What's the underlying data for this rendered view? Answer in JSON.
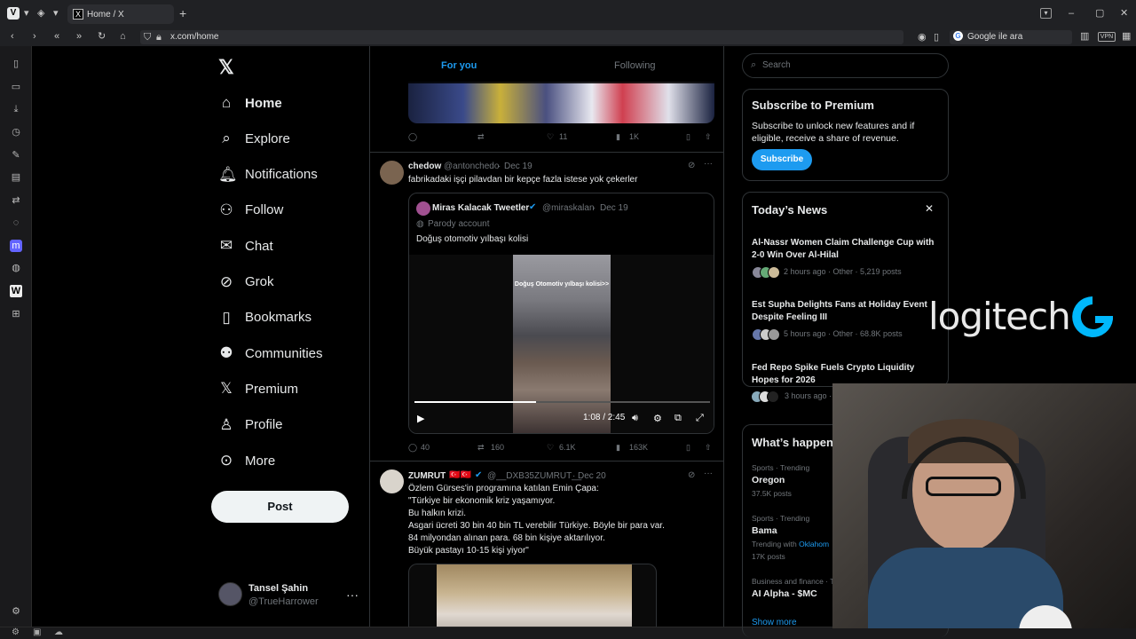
{
  "browser": {
    "tab_title": "Home / X",
    "url": "x.com/home",
    "search_placeholder": "Google ile ara",
    "vpn_label": "VPN"
  },
  "nav": {
    "items": [
      {
        "label": "Home",
        "icon": "home-icon"
      },
      {
        "label": "Explore",
        "icon": "search-icon"
      },
      {
        "label": "Notifications",
        "icon": "bell-icon"
      },
      {
        "label": "Follow",
        "icon": "person-plus-icon"
      },
      {
        "label": "Chat",
        "icon": "mail-icon"
      },
      {
        "label": "Grok",
        "icon": "grok-icon"
      },
      {
        "label": "Bookmarks",
        "icon": "bookmark-icon"
      },
      {
        "label": "Communities",
        "icon": "people-icon"
      },
      {
        "label": "Premium",
        "icon": "x-logo-icon"
      },
      {
        "label": "Profile",
        "icon": "person-icon"
      },
      {
        "label": "More",
        "icon": "more-circle-icon"
      }
    ],
    "post_label": "Post",
    "profile": {
      "name": "Tansel Şahin",
      "handle": "@TrueHarrower"
    }
  },
  "timeline": {
    "tabs": [
      "For you",
      "Following"
    ],
    "prev_tweet_actions": {
      "likes": "11",
      "views": "1K"
    },
    "tweet1": {
      "name": "chedow",
      "handle": "@antonchedo",
      "date": "Dec 19",
      "text": "fabrikadaki işçi pilavdan bir kepçe fazla istese yok çekerler",
      "quote": {
        "name": "Miras Kalacak Tweetler",
        "handle": "@miraskalan",
        "date": "Dec 19",
        "label": "Parody account",
        "text": "Doğuş otomotiv yılbaşı kolisi",
        "video_caption": "Doğuş Otomotiv yılbaşı kolisi>>",
        "time": "1:08 / 2:45",
        "progress": 0.41
      },
      "actions": {
        "replies": "40",
        "reposts": "160",
        "likes": "6.1K",
        "views": "163K"
      }
    },
    "tweet2": {
      "name": "ZUMRUT",
      "flags": "🇹🇷🇹🇷",
      "handle": "@__DXB35ZUMRUT__",
      "date": "Dec 20",
      "lines": [
        "Özlem Gürses'in programına katılan Emin Çapa:",
        "\"Türkiye bir ekonomik kriz yaşamıyor.",
        "Bu halkın krizi.",
        "Asgari ücreti 30 bin 40 bin TL verebilir Türkiye. Böyle bir para var.",
        "84 milyondan alınan para. 68 bin kişiye aktarılıyor.",
        "Büyük pastayı 10-15 kişi yiyor\""
      ]
    }
  },
  "sidebar": {
    "search_placeholder": "Search",
    "premium": {
      "title": "Subscribe to Premium",
      "body": "Subscribe to unlock new features and if eligible, receive a share of revenue.",
      "button": "Subscribe"
    },
    "news": {
      "title": "Today’s News",
      "items": [
        {
          "headline": "Al-Nassr Women Claim Challenge Cup with 2-0 Win Over Al-Hilal",
          "meta": "2 hours ago · Other · 5,219 posts"
        },
        {
          "headline": "Est Supha Delights Fans at Holiday Event Despite Feeling III",
          "meta": "5 hours ago · Other · 68.8K posts"
        },
        {
          "headline": "Fed Repo Spike Fuels Crypto Liquidity Hopes for 2026",
          "meta": "3 hours ago · O"
        }
      ]
    },
    "happening": {
      "title": "What’s happen",
      "trends": [
        {
          "category": "Sports · Trending",
          "name": "Oregon",
          "count": "37.5K posts"
        },
        {
          "category": "Sports · Trending",
          "name": "Bama",
          "extra": "Trending with",
          "extra_link": "Oklahom",
          "count": "17K posts"
        },
        {
          "category": "Business and finance · Tre",
          "name": "AI Alpha - $MC",
          "count": ""
        }
      ],
      "show_more": "Show more"
    }
  },
  "overlay": {
    "brand": "logitech"
  }
}
